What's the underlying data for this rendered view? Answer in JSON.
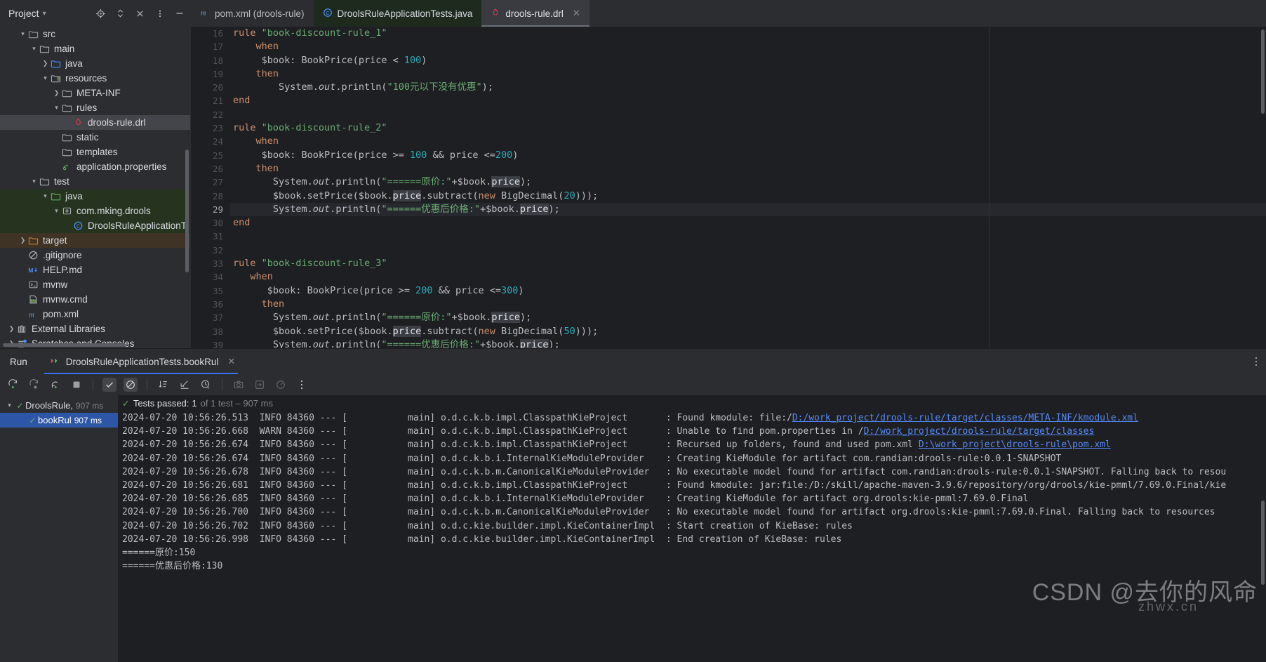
{
  "project_panel": {
    "title": "Project",
    "icons": [
      "locate-icon",
      "expand-collapse-icon",
      "close-icon",
      "more-options-icon",
      "minimize-icon"
    ],
    "tree": [
      {
        "indent": 1,
        "arrow": "v",
        "icon": "folder-src-icon",
        "label": "src",
        "state": "normal"
      },
      {
        "indent": 2,
        "arrow": "v",
        "icon": "folder-icon",
        "label": "main",
        "state": "normal"
      },
      {
        "indent": 3,
        "arrow": ">",
        "icon": "folder-source-icon",
        "label": "java",
        "state": "normal"
      },
      {
        "indent": 3,
        "arrow": "v",
        "icon": "folder-resources-icon",
        "label": "resources",
        "state": "normal"
      },
      {
        "indent": 4,
        "arrow": ">",
        "icon": "folder-icon",
        "label": "META-INF",
        "state": "normal"
      },
      {
        "indent": 4,
        "arrow": "v",
        "icon": "folder-icon",
        "label": "rules",
        "state": "normal"
      },
      {
        "indent": 5,
        "arrow": "",
        "icon": "drl-file-icon",
        "label": "drools-rule.drl",
        "state": "selected"
      },
      {
        "indent": 4,
        "arrow": "",
        "icon": "folder-icon",
        "label": "static",
        "state": "normal"
      },
      {
        "indent": 4,
        "arrow": "",
        "icon": "folder-icon",
        "label": "templates",
        "state": "normal"
      },
      {
        "indent": 4,
        "arrow": "",
        "icon": "properties-file-icon",
        "label": "application.properties",
        "state": "normal"
      },
      {
        "indent": 2,
        "arrow": "v",
        "icon": "folder-icon",
        "label": "test",
        "state": "normal"
      },
      {
        "indent": 3,
        "arrow": "v",
        "icon": "folder-test-source-icon",
        "label": "java",
        "state": "test-source"
      },
      {
        "indent": 4,
        "arrow": "v",
        "icon": "package-icon",
        "label": "com.mking.drools",
        "state": "test-source"
      },
      {
        "indent": 5,
        "arrow": "",
        "icon": "java-class-icon",
        "label": "DroolsRuleApplicationTests",
        "state": "test-source"
      },
      {
        "indent": 1,
        "arrow": ">",
        "icon": "folder-excluded-icon",
        "label": "target",
        "state": "excluded"
      },
      {
        "indent": 1,
        "arrow": "",
        "icon": "gitignore-icon",
        "label": ".gitignore",
        "state": "normal"
      },
      {
        "indent": 1,
        "arrow": "",
        "icon": "markdown-icon",
        "label": "HELP.md",
        "state": "normal"
      },
      {
        "indent": 1,
        "arrow": "",
        "icon": "shell-script-icon",
        "label": "mvnw",
        "state": "normal"
      },
      {
        "indent": 1,
        "arrow": "",
        "icon": "cmd-file-icon",
        "label": "mvnw.cmd",
        "state": "normal"
      },
      {
        "indent": 1,
        "arrow": "",
        "icon": "maven-pom-icon",
        "label": "pom.xml",
        "state": "normal"
      },
      {
        "indent": 0,
        "arrow": ">",
        "icon": "external-libraries-icon",
        "label": "External Libraries",
        "state": "normal"
      },
      {
        "indent": 0,
        "arrow": ">",
        "icon": "scratches-icon",
        "label": "Scratches and Consoles",
        "state": "normal"
      }
    ]
  },
  "editor_tabs": [
    {
      "label": "pom.xml (drools-rule)",
      "icon": "maven-pom-icon",
      "state": "inactive",
      "closable": false
    },
    {
      "label": "DroolsRuleApplicationTests.java",
      "icon": "java-class-icon",
      "state": "modified",
      "closable": false
    },
    {
      "label": "drools-rule.drl",
      "icon": "drl-file-icon",
      "state": "current",
      "closable": true
    }
  ],
  "editor": {
    "first_line": 16,
    "current_line": 29,
    "lines": [
      {
        "n": 16,
        "tokens": [
          {
            "t": "rule ",
            "c": "k"
          },
          {
            "t": "\"book-discount-rule_1\"",
            "c": "s"
          }
        ]
      },
      {
        "n": 17,
        "tokens": [
          {
            "t": "    when",
            "c": "k"
          }
        ]
      },
      {
        "n": 18,
        "tokens": [
          {
            "t": "     ",
            "c": "id"
          },
          {
            "t": "$book",
            "c": "id"
          },
          {
            "t": ": BookPrice(price < ",
            "c": "id"
          },
          {
            "t": "100",
            "c": "n"
          },
          {
            "t": ")",
            "c": "id"
          }
        ]
      },
      {
        "n": 19,
        "tokens": [
          {
            "t": "    then",
            "c": "k"
          }
        ]
      },
      {
        "n": 20,
        "tokens": [
          {
            "t": "        System.",
            "c": "id"
          },
          {
            "t": "out",
            "c": "it"
          },
          {
            "t": ".println(",
            "c": "id"
          },
          {
            "t": "\"100元以下没有优惠\"",
            "c": "s"
          },
          {
            "t": ");",
            "c": "id"
          }
        ]
      },
      {
        "n": 21,
        "tokens": [
          {
            "t": "end",
            "c": "k"
          }
        ]
      },
      {
        "n": 22,
        "tokens": []
      },
      {
        "n": 23,
        "tokens": [
          {
            "t": "rule ",
            "c": "k"
          },
          {
            "t": "\"book-discount-rule_2\"",
            "c": "s"
          }
        ]
      },
      {
        "n": 24,
        "tokens": [
          {
            "t": "    when",
            "c": "k"
          }
        ]
      },
      {
        "n": 25,
        "tokens": [
          {
            "t": "     $book: BookPrice(price >= ",
            "c": "id"
          },
          {
            "t": "100",
            "c": "n"
          },
          {
            "t": " && price <=",
            "c": "id"
          },
          {
            "t": "200",
            "c": "n"
          },
          {
            "t": ")",
            "c": "id"
          }
        ]
      },
      {
        "n": 26,
        "tokens": [
          {
            "t": "    then",
            "c": "k"
          }
        ]
      },
      {
        "n": 27,
        "tokens": [
          {
            "t": "       System.",
            "c": "id"
          },
          {
            "t": "out",
            "c": "it"
          },
          {
            "t": ".println(",
            "c": "id"
          },
          {
            "t": "\"======原价:\"",
            "c": "s"
          },
          {
            "t": "+$book.",
            "c": "id"
          },
          {
            "t": "price",
            "c": "hl"
          },
          {
            "t": ");",
            "c": "id"
          }
        ]
      },
      {
        "n": 28,
        "tokens": [
          {
            "t": "       $book.setPrice($book.",
            "c": "id"
          },
          {
            "t": "price",
            "c": "hl"
          },
          {
            "t": ".subtract(",
            "c": "id"
          },
          {
            "t": "new",
            "c": "k"
          },
          {
            "t": " BigDecimal(",
            "c": "id"
          },
          {
            "t": "20",
            "c": "n"
          },
          {
            "t": ")));",
            "c": "id"
          }
        ]
      },
      {
        "n": 29,
        "tokens": [
          {
            "t": "       System.",
            "c": "id"
          },
          {
            "t": "out",
            "c": "it"
          },
          {
            "t": ".println(",
            "c": "id"
          },
          {
            "t": "\"======优惠后价格:\"",
            "c": "s"
          },
          {
            "t": "+$book.",
            "c": "id"
          },
          {
            "t": "price",
            "c": "hl"
          },
          {
            "t": ");",
            "c": "id"
          }
        ]
      },
      {
        "n": 30,
        "tokens": [
          {
            "t": "end",
            "c": "k"
          }
        ]
      },
      {
        "n": 31,
        "tokens": []
      },
      {
        "n": 32,
        "tokens": []
      },
      {
        "n": 33,
        "tokens": [
          {
            "t": "rule ",
            "c": "k"
          },
          {
            "t": "\"book-discount-rule_3\"",
            "c": "s"
          }
        ]
      },
      {
        "n": 34,
        "tokens": [
          {
            "t": "   when",
            "c": "k"
          }
        ]
      },
      {
        "n": 35,
        "tokens": [
          {
            "t": "      $book: BookPrice(price >= ",
            "c": "id"
          },
          {
            "t": "200",
            "c": "n"
          },
          {
            "t": " && price <=",
            "c": "id"
          },
          {
            "t": "300",
            "c": "n"
          },
          {
            "t": ")",
            "c": "id"
          }
        ]
      },
      {
        "n": 36,
        "tokens": [
          {
            "t": "     then",
            "c": "k"
          }
        ]
      },
      {
        "n": 37,
        "tokens": [
          {
            "t": "       System.",
            "c": "id"
          },
          {
            "t": "out",
            "c": "it"
          },
          {
            "t": ".println(",
            "c": "id"
          },
          {
            "t": "\"======原价:\"",
            "c": "s"
          },
          {
            "t": "+$book.",
            "c": "id"
          },
          {
            "t": "price",
            "c": "hl"
          },
          {
            "t": ");",
            "c": "id"
          }
        ]
      },
      {
        "n": 38,
        "tokens": [
          {
            "t": "       $book.setPrice($book.",
            "c": "id"
          },
          {
            "t": "price",
            "c": "hl"
          },
          {
            "t": ".subtract(",
            "c": "id"
          },
          {
            "t": "new",
            "c": "k"
          },
          {
            "t": " BigDecimal(",
            "c": "id"
          },
          {
            "t": "50",
            "c": "n"
          },
          {
            "t": ")));",
            "c": "id"
          }
        ]
      },
      {
        "n": 39,
        "tokens": [
          {
            "t": "       System.",
            "c": "id"
          },
          {
            "t": "out",
            "c": "it"
          },
          {
            "t": ".println(",
            "c": "id"
          },
          {
            "t": "\"======优惠后价格:\"",
            "c": "s"
          },
          {
            "t": "+$book.",
            "c": "id"
          },
          {
            "t": "price",
            "c": "hl"
          },
          {
            "t": ");",
            "c": "id"
          }
        ]
      }
    ]
  },
  "run_window": {
    "title": "Run",
    "tab_label": "DroolsRuleApplicationTests.bookRul",
    "tab_icon": "run-test-icon",
    "close_icon": "close-icon",
    "more_icon": "more-options-icon",
    "toolbar": [
      {
        "name": "rerun-icon",
        "state": "normal"
      },
      {
        "name": "rerun-failed-tests-icon",
        "state": "normal"
      },
      {
        "name": "toggle-auto-test-icon",
        "state": "normal"
      },
      {
        "name": "stop-icon",
        "state": "normal"
      },
      {
        "name": "show-passed-icon",
        "state": "on"
      },
      {
        "name": "show-ignored-icon",
        "state": "on"
      },
      {
        "name": "sort-alphabetically-icon",
        "state": "normal"
      },
      {
        "name": "collapse-all-icon",
        "state": "normal"
      },
      {
        "name": "sort-by-duration-icon",
        "state": "normal"
      },
      {
        "name": "export-screenshot-icon",
        "state": "dim"
      },
      {
        "name": "export-test-results-icon",
        "state": "dim"
      },
      {
        "name": "test-history-icon",
        "state": "dim"
      },
      {
        "name": "more-options-icon",
        "state": "normal"
      }
    ],
    "test_tree": [
      {
        "indent": 0,
        "arrow": "v",
        "name": "DroolsRule,",
        "duration": "907 ms",
        "selected": false
      },
      {
        "indent": 1,
        "arrow": "",
        "name": "bookRul",
        "duration": "907 ms",
        "selected": true
      }
    ],
    "status": {
      "passed_label": "Tests passed:",
      "passed_count": "1",
      "of_text": "of 1 test – 907 ms"
    },
    "console_lines": [
      {
        "parts": [
          {
            "t": "2024-07-20 10:56:26.513  INFO 84360 --- [           main] o.d.c.k.b.impl.ClasspathKieProject       : Found kmodule: file:/",
            "link": false
          },
          {
            "t": "D:/work_project/drools-rule/target/classes/META-INF/kmodule.xml",
            "link": true
          }
        ]
      },
      {
        "parts": [
          {
            "t": "2024-07-20 10:56:26.668  WARN 84360 --- [           main] o.d.c.k.b.impl.ClasspathKieProject       : Unable to find pom.properties in /",
            "link": false
          },
          {
            "t": "D:/work_project/drools-rule/target/classes",
            "link": true
          }
        ]
      },
      {
        "parts": [
          {
            "t": "2024-07-20 10:56:26.674  INFO 84360 --- [           main] o.d.c.k.b.impl.ClasspathKieProject       : Recursed up folders, found and used pom.xml ",
            "link": false
          },
          {
            "t": "D:\\work_project\\drools-rule\\pom.xml",
            "link": true
          }
        ]
      },
      {
        "parts": [
          {
            "t": "2024-07-20 10:56:26.674  INFO 84360 --- [           main] o.d.c.k.b.i.InternalKieModuleProvider    : Creating KieModule for artifact com.randian:drools-rule:0.0.1-SNAPSHOT",
            "link": false
          }
        ]
      },
      {
        "parts": [
          {
            "t": "2024-07-20 10:56:26.678  INFO 84360 --- [           main] o.d.c.k.b.m.CanonicalKieModuleProvider   : No executable model found for artifact com.randian:drools-rule:0.0.1-SNAPSHOT. Falling back to resou",
            "link": false
          }
        ]
      },
      {
        "parts": [
          {
            "t": "2024-07-20 10:56:26.681  INFO 84360 --- [           main] o.d.c.k.b.impl.ClasspathKieProject       : Found kmodule: jar:file:/D:/skill/apache-maven-3.9.6/repository/org/drools/kie-pmml/7.69.0.Final/kie",
            "link": false
          }
        ]
      },
      {
        "parts": [
          {
            "t": "2024-07-20 10:56:26.685  INFO 84360 --- [           main] o.d.c.k.b.i.InternalKieModuleProvider    : Creating KieModule for artifact org.drools:kie-pmml:7.69.0.Final",
            "link": false
          }
        ]
      },
      {
        "parts": [
          {
            "t": "2024-07-20 10:56:26.700  INFO 84360 --- [           main] o.d.c.k.b.m.CanonicalKieModuleProvider   : No executable model found for artifact org.drools:kie-pmml:7.69.0.Final. Falling back to resources ",
            "link": false
          }
        ]
      },
      {
        "parts": [
          {
            "t": "2024-07-20 10:56:26.702  INFO 84360 --- [           main] o.d.c.kie.builder.impl.KieContainerImpl  : Start creation of KieBase: rules",
            "link": false
          }
        ]
      },
      {
        "parts": [
          {
            "t": "2024-07-20 10:56:26.998  INFO 84360 --- [           main] o.d.c.kie.builder.impl.KieContainerImpl  : End creation of KieBase: rules",
            "link": false
          }
        ]
      },
      {
        "parts": [
          {
            "t": "======原价:150",
            "link": false
          }
        ]
      },
      {
        "parts": [
          {
            "t": "======优惠后价格:130",
            "link": false
          }
        ]
      }
    ]
  },
  "watermark": {
    "text": "CSDN @去你的风命",
    "sub": "zhwx.cn"
  },
  "colors": {
    "accent_blue": "#3574f0",
    "selection_blue": "#2e56a6",
    "test_source_green": "#26341f",
    "excluded_brown": "#3e3324",
    "pass_green": "#5fad65",
    "link_blue": "#548af7"
  }
}
